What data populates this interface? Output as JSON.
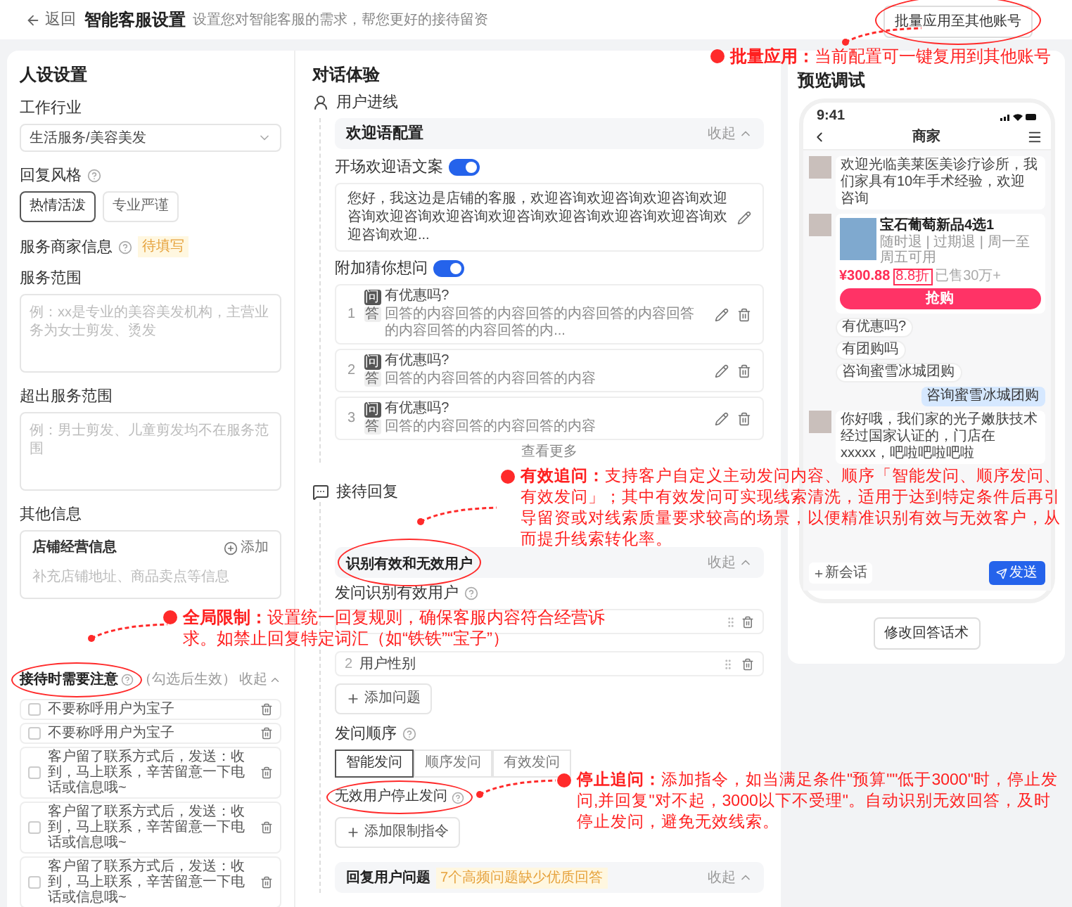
{
  "header": {
    "back": "返回",
    "title": "智能客服设置",
    "subtitle": "设置您对智能客服的需求，帮您更好的接待留资",
    "batch_button": {
      "label": "批量应用至其他账号",
      "circled": true
    }
  },
  "persona": {
    "title": "人设设置",
    "industry": {
      "label": "工作行业",
      "value": "生活服务/美容美发"
    },
    "style": {
      "label": "回复风格",
      "options": [
        {
          "label": "热情活泼",
          "selected": true
        },
        {
          "label": "专业严谨",
          "selected": false
        }
      ]
    },
    "merchant": {
      "label": "服务商家信息",
      "badge": "待填写"
    },
    "scope": {
      "label": "服务范围",
      "placeholder": "例：xx是专业的美容美发机构，主营业务为女士剪发、烫发"
    },
    "out_scope": {
      "label": "超出服务范围",
      "placeholder": "例：男士剪发、儿童剪发均不在服务范围"
    },
    "other": {
      "label": "其他信息",
      "store": {
        "title": "店铺经营信息",
        "add": "添加",
        "desc": "补充店铺地址、商品卖点等信息"
      }
    },
    "notes": {
      "title": "接待时需要注意",
      "circled": true,
      "hint": "（勾选后生效）",
      "collapse": "收起",
      "items": [
        {
          "text": "不要称呼用户为宝子",
          "checked": false
        },
        {
          "text": "不要称呼用户为宝子",
          "checked": false
        },
        {
          "text": "客户留了联系方式后，发送：收到，马上联系，辛苦留意一下电话或信息哦~",
          "checked": false
        },
        {
          "text": "客户留了联系方式后，发送：收到，马上联系，辛苦留意一下电话或信息哦~",
          "checked": false
        },
        {
          "text": "客户留了联系方式后，发送：收到，马上联系，辛苦留意一下电话或信息哦~",
          "checked": false
        }
      ]
    }
  },
  "dialog": {
    "title": "对话体验",
    "entry": {
      "title": "用户进线",
      "card": {
        "title": "欢迎语配置",
        "collapse": "收起"
      },
      "welcome_toggle": {
        "label": "开场欢迎语文案",
        "on": true
      },
      "welcome_text": "您好，我这边是店铺的客服，欢迎咨询欢迎咨询欢迎咨询欢迎咨询欢迎咨询欢迎咨询欢迎咨询欢迎咨询欢迎咨询欢迎咨询欢迎咨询欢迎...",
      "guess_toggle": {
        "label": "附加猜你想问",
        "on": true
      },
      "faqs": [
        {
          "index": "1",
          "q_badge": "问",
          "question": "有优惠吗?",
          "a_badge": "答",
          "answer": "回答的内容回答的内容回答的内容回答的内容回答的内容回答的内容回答的内..."
        },
        {
          "index": "2",
          "q_badge": "问",
          "question": "有优惠吗?",
          "a_badge": "答",
          "answer": "回答的内容回答的内容回答的内容"
        },
        {
          "index": "3",
          "q_badge": "问",
          "question": "有优惠吗?",
          "a_badge": "答",
          "answer": "回答的内容回答的内容回答的内容"
        }
      ],
      "more": "查看更多"
    },
    "reception": {
      "title": "接待回复",
      "card": {
        "title": "识别有效和无效用户",
        "circled": true,
        "collapse": "收起"
      },
      "ask_label": "发问识别有效用户",
      "questions": [
        {
          "index": "2",
          "text": "用户性别"
        }
      ],
      "add_question": "添加问题",
      "order_label": "发问顺序",
      "order_options": [
        {
          "label": "智能发问",
          "selected": true
        },
        {
          "label": "顺序发问",
          "selected": false
        },
        {
          "label": "有效发问",
          "selected": false
        }
      ],
      "stop": {
        "label": "无效用户停止发问",
        "circled": true
      },
      "add_rule": "添加限制指令",
      "reply_card": {
        "title": "回复用户问题",
        "badge": "7个高频问题缺少优质回答",
        "collapse": "收起"
      }
    }
  },
  "preview": {
    "title": "预览调试",
    "phone": {
      "time": "9:41",
      "title": "商家",
      "bot_message": "欢迎光临美莱医美诊疗诊所，我们家具有10年手术经验，欢迎咨询",
      "product": {
        "name": "宝石葡萄新品4选1",
        "tags": "随时退 | 过期退 | 周一至周五可用",
        "price": "¥300.88",
        "discount": "8.8折",
        "sold": "已售30万+",
        "buy": "抢购"
      },
      "suggestions": [
        "有优惠吗?",
        "有团购吗",
        "咨询蜜雪冰城团购"
      ],
      "user_message": "咨询蜜雪冰城团购",
      "bot_reply": "你好哦，我们家的光子嫩肤技术经过国家认证的，门店在xxxxx，吧啦吧啦吧啦",
      "new_chat": "新会话",
      "send": "发送"
    },
    "edit_button": "修改回答话术"
  },
  "annotations": [
    {
      "text": "**批量应用：**当前配置可一键复用到其他账号"
    },
    {
      "text": "**有效追问：**支持客户自定义主动发问内容、顺序「智能发问、顺序发问、有效发问」；其中有效发问可实现线索清洗，适用于达到特定条件后再引导留资或对线索质量要求较高的场景，以便精准识别有效与无效客户，从而提升线索转化率。"
    },
    {
      "text": "**全局限制：**设置统一回复规则，确保客服内容符合经营诉求。如禁止回复特定词汇（如“铁铁”“宝子”）"
    },
    {
      "text": "**停止追问：**添加指令，如当满足条件\"预算\"\"低于3000\"时，停止发问,并回复\"对不起，3000以下不受理\"。自动识别无效回答，及时停止发问，避免无效线索。"
    }
  ]
}
